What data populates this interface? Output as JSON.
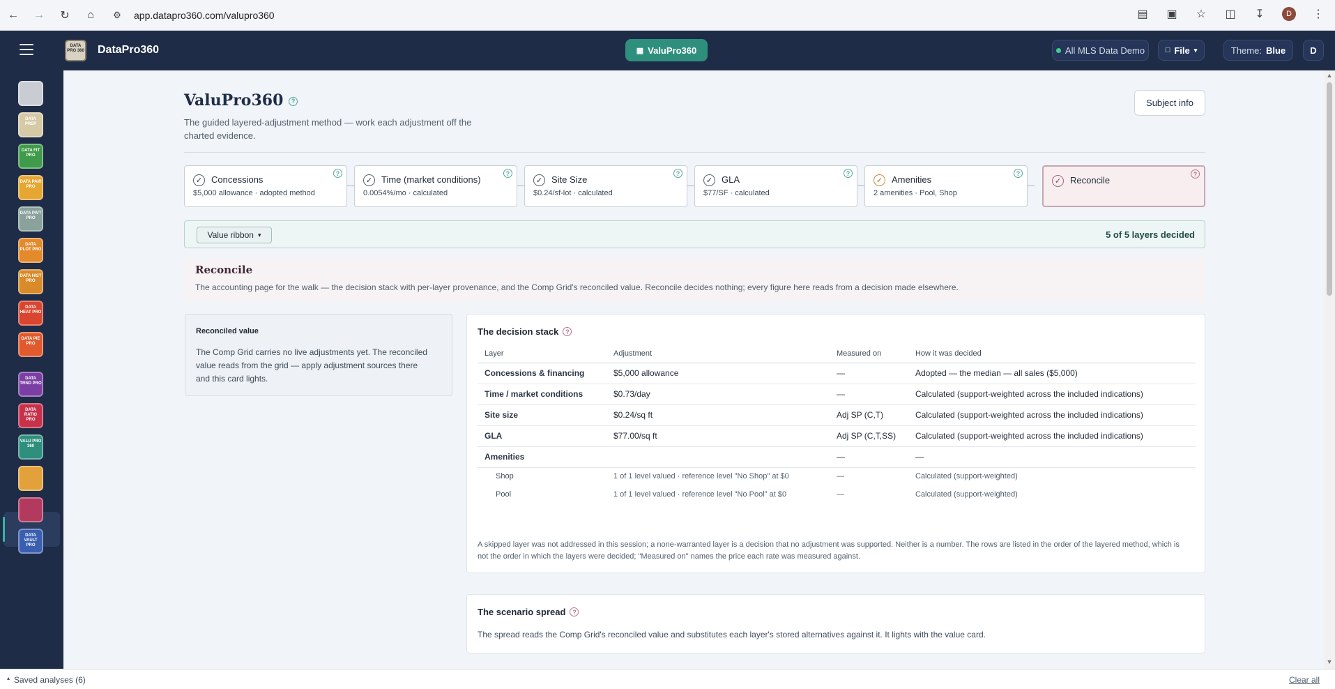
{
  "browser": {
    "url": "app.datapro360.com/valupro360"
  },
  "header": {
    "brand_logo_text": "DATA PRO 360",
    "brand_name": "DataPro360",
    "center_pill": "ValuPro360",
    "mls_label": "All MLS Data Demo",
    "file_label": "File",
    "theme_prefix": "Theme:",
    "theme_value": "Blue",
    "user_initial": "D",
    "browser_profile_initial": "D"
  },
  "rail": {
    "items": [
      {
        "label": "",
        "color": "#c9ccd3"
      },
      {
        "label": "DATA PREP",
        "color": "#d5c9a6"
      },
      {
        "label": "DATA FIT PRO",
        "color": "#3f9b4a"
      },
      {
        "label": "DATA PAIR PRO",
        "color": "#e5a632"
      },
      {
        "label": "DATA PIVT PRO",
        "color": "#8aa19c"
      },
      {
        "label": "DATA PLOT PRO",
        "color": "#e38a2c"
      },
      {
        "label": "DATA HIST PRO",
        "color": "#d98b2a"
      },
      {
        "label": "DATA HEAT PRO",
        "color": "#d9452e"
      },
      {
        "label": "DATA PIE PRO",
        "color": "#e05a2d"
      },
      {
        "label": "DATA TRND PRO",
        "color": "#7b3fa3"
      },
      {
        "label": "DATA RATIO PRO",
        "color": "#c7324a"
      },
      {
        "label": "VALU PRO 360",
        "color": "#2f8f7d"
      },
      {
        "label": "",
        "color": "#e2a13a"
      },
      {
        "label": "",
        "color": "#b23a5e"
      },
      {
        "label": "DATA VAULT PRO",
        "color": "#3a5fb0"
      }
    ]
  },
  "page": {
    "title": "ValuPro360",
    "subtitle": "The guided layered-adjustment method — work each adjustment off the charted evidence.",
    "subject_button": "Subject info"
  },
  "steps": [
    {
      "title": "Concessions",
      "sub": "$5,000 allowance · adopted method"
    },
    {
      "title": "Time (market conditions)",
      "sub": "0.0054%/mo · calculated"
    },
    {
      "title": "Site Size",
      "sub": "$0.24/sf-lot · calculated"
    },
    {
      "title": "GLA",
      "sub": "$77/SF · calculated"
    },
    {
      "title": "Amenities",
      "sub": "2 amenities · Pool, Shop"
    },
    {
      "title": "Reconcile",
      "sub": ""
    }
  ],
  "ribbon": {
    "button": "Value ribbon",
    "status": "5 of 5 layers decided"
  },
  "reconcile": {
    "title": "Reconcile",
    "description": "The accounting page for the walk — the decision stack with per-layer provenance, and the Comp Grid's reconciled value. Reconcile decides nothing; every figure here reads from a decision made elsewhere."
  },
  "value_card": {
    "title": "Reconciled value",
    "body": "The Comp Grid carries no live adjustments yet. The reconciled value reads from the grid — apply adjustment sources there and this card lights."
  },
  "stack": {
    "title": "The decision stack",
    "columns": [
      "Layer",
      "Adjustment",
      "Measured on",
      "How it was decided"
    ],
    "rows": [
      {
        "layer": "Concessions & financing",
        "adjustment": "$5,000 allowance",
        "measured": "—",
        "how": "Adopted — the median — all sales ($5,000)"
      },
      {
        "layer": "Time / market conditions",
        "adjustment": "$0.73/day",
        "measured": "—",
        "how": "Calculated (support-weighted across the included indications)"
      },
      {
        "layer": "Site size",
        "adjustment": "$0.24/sq ft",
        "measured": "Adj SP (C,T)",
        "how": "Calculated (support-weighted across the included indications)"
      },
      {
        "layer": "GLA",
        "adjustment": "$77.00/sq ft",
        "measured": "Adj SP (C,T,SS)",
        "how": "Calculated (support-weighted across the included indications)"
      },
      {
        "layer": "Amenities",
        "adjustment": "",
        "measured": "—",
        "how": "—"
      }
    ],
    "subrows": [
      {
        "layer": "Shop",
        "adjustment": "1 of 1 level valued · reference level \"No Shop\" at $0",
        "measured": "—",
        "how": "Calculated (support-weighted)"
      },
      {
        "layer": "Pool",
        "adjustment": "1 of 1 level valued · reference level \"No Pool\" at $0",
        "measured": "—",
        "how": "Calculated (support-weighted)"
      }
    ],
    "note": "A skipped layer was not addressed in this session; a none-warranted layer is a decision that no adjustment was supported. Neither is a number. The rows are listed in the order of the layered method, which is not the order in which the layers were decided; \"Measured on\" names the price each rate was measured against."
  },
  "spread": {
    "title": "The scenario spread",
    "body": "The spread reads the Comp Grid's reconciled value and substitutes each layer's stored alternatives against it. It lights with the value card."
  },
  "footer": {
    "saved": "Saved analyses (6)",
    "clear": "Clear all"
  }
}
